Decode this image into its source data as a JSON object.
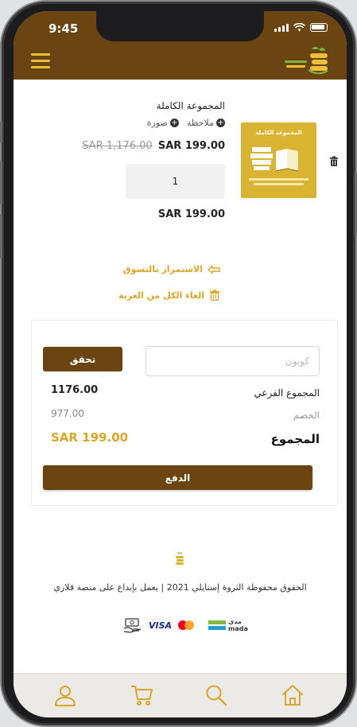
{
  "status_bar": {
    "time": "9:45"
  },
  "cart": {
    "item": {
      "title": "المجموعة الكاملة",
      "add_note": "ملاحظة",
      "add_image": "صورة",
      "price_old": "SAR 1,176.00",
      "price_new": "SAR 199.00",
      "quantity": "1",
      "line_total": "SAR 199.00",
      "image_caption": "المجموعة الكاملة"
    },
    "continue_shopping": "الاستمرار بالتسوق",
    "clear_cart": "الغاء الكل من العربة"
  },
  "summary": {
    "coupon_placeholder": "كوبون",
    "verify_label": "تحقق",
    "subtotal_label": "المجموع الفرعي",
    "subtotal_value": "1176.00",
    "discount_label": "الخصم",
    "discount_value": "977.00",
    "total_label": "المجموع",
    "total_value": "SAR 199.00",
    "pay_label": "الدفع"
  },
  "footer": {
    "copyright": "الحقوق محفوظة الثروة إستايلي 2021 | يعمل بإبداع على منصة قلاري",
    "payment_visa": "VISA",
    "payment_mada_ar": "مدى",
    "payment_mada_en": "mada"
  },
  "tabs": [
    "account-icon",
    "cart-icon",
    "search-icon",
    "home-icon"
  ],
  "colors": {
    "brand_brown": "#6b4511",
    "accent_gold": "#e9c23a",
    "link_gold": "#d9a52a",
    "total_gold": "#d9a52a"
  }
}
